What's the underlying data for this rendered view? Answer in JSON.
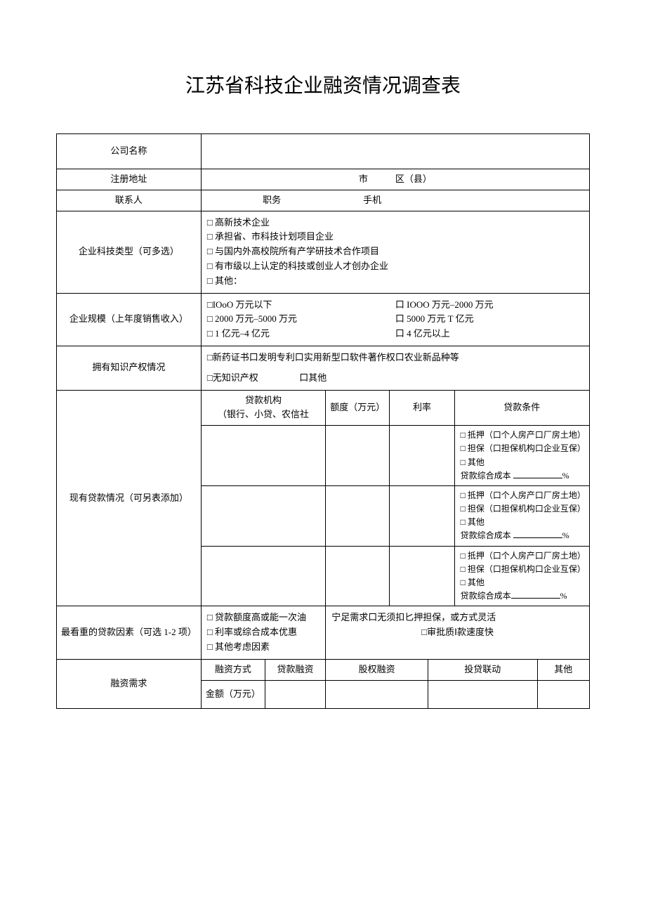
{
  "title": "江苏省科技企业融资情况调查表",
  "rows": {
    "company_name": "公司名称",
    "reg_address": "注册地址",
    "reg_address_city": "市",
    "reg_address_district": "区（县）",
    "contact": "联系人",
    "position": "职务",
    "phone": "手机",
    "tech_type": "企业科技类型（可多选）",
    "tech_opts": [
      "□ 高新技术企业",
      "□ 承担省、市科技计划项目企业",
      "□ 与国内外高校院所有产学研技术合作项目",
      "□ 有市级以上认定的科技或创业人才创办企业",
      "□ 其他："
    ],
    "scale": "企业规模（上年度销售收入）",
    "scale_opts_l": [
      "□IOoO 万元以下",
      "□ 2000 万元–5000 万元",
      "□ 1 亿元–4 亿元"
    ],
    "scale_opts_r": [
      "口 IOOO 万元–2000 万元",
      "口 5000 万元 T 亿元",
      "口 4 亿元以上"
    ],
    "ip": "拥有知识产权情况",
    "ip_line1": "□新药证书口发明专利口实用新型口软件著作权口农业新品种等",
    "ip_line2a": "□无知识产权",
    "ip_line2b": "口其他",
    "loans": "现有贷款情况（可另表添加）",
    "loan_h1": "贷款机构",
    "loan_h1b": "（银行、小贷、农信社",
    "loan_h2": "额度（万元）",
    "loan_h3": "利率",
    "loan_h4": "贷款条件",
    "loan_c1": "□ 抵押（口个人房产口厂房土地）",
    "loan_c2": "□ 担保（口担保机构口企业互保）",
    "loan_c3": "□ 其他",
    "loan_c4a": "贷款综合成本",
    "loan_c4b": "%",
    "factor": "最看重的贷款因素（可选 1-2 项）",
    "factor_l": [
      "□ 贷款额度高或能一次油",
      "□ 利率或综合成本优惠",
      "□ 其他考虑因素"
    ],
    "factor_r1": "宁足需求口无须扣匕押担保，或方式灵活",
    "factor_r2": "□审批质Ⅰ款速度快",
    "need": "融资需求",
    "need_mode": "融资方式",
    "need_loan": "贷款融资",
    "need_equity": "股权融资",
    "need_link": "投贷联动",
    "need_other": "其他",
    "need_amount": "金额（万元）"
  }
}
